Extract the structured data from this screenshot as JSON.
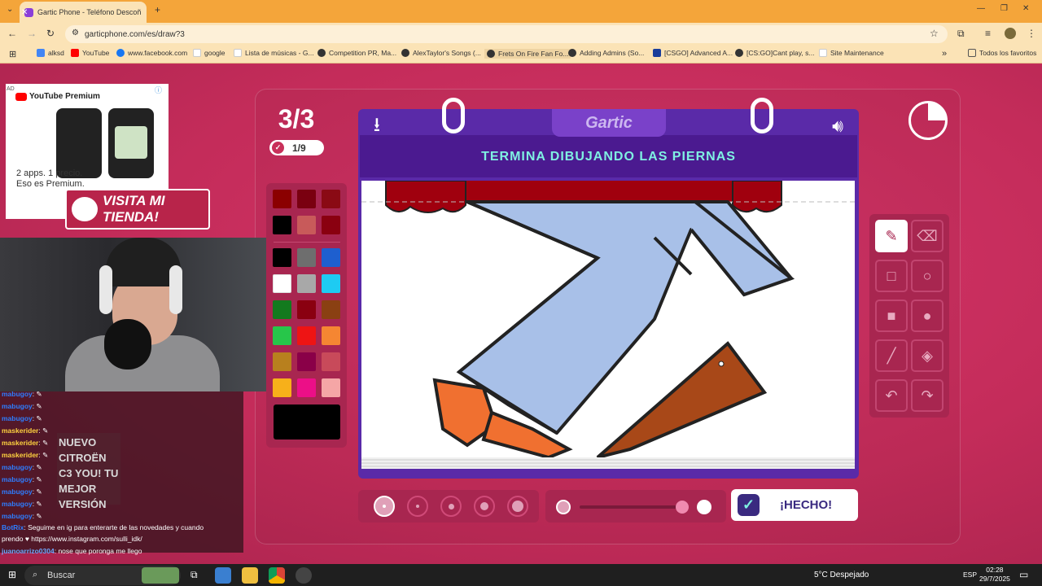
{
  "browser": {
    "tab_title": "Gartic Phone - Teléfono Descoñ",
    "url": "garticphone.com/es/draw?3",
    "bookmarks": [
      "alksd",
      "YouTube",
      "www.facebook.com",
      "google",
      "Lista de músicas - G...",
      "Competition PR, Ma...",
      "AlexTaylor's Songs (...",
      "Frets On Fire Fan Fo...",
      "Adding Admins (So...",
      "[CSGO] Advanced A...",
      "[CS:GO]Cant play, s...",
      "Site Maintenance"
    ],
    "all_bookmarks": "Todos los favoritos"
  },
  "ad": {
    "tag": "AD",
    "brand": "YouTube Premium",
    "line1": "2 apps. 1 precio.",
    "line2": "Eso es Premium."
  },
  "stream": {
    "store_banner": "VISITA MI TIENDA!",
    "car_ad": "NUEVO CITROËN C3 YOU! TU MEJOR VERSIÓN",
    "chat": [
      {
        "user": "mabugoy",
        "text": ": ✎"
      },
      {
        "user": "mabugoy",
        "text": ": ✎"
      },
      {
        "user": "mabugoy",
        "text": ": ✎"
      },
      {
        "user": "maskerider",
        "text": ": ✎"
      },
      {
        "user": "maskerider",
        "text": ": ✎"
      },
      {
        "user": "maskerider",
        "text": ": ✎"
      },
      {
        "user": "mabugoy",
        "text": ": ✎"
      },
      {
        "user": "mabugoy",
        "text": ": ✎"
      },
      {
        "user": "mabugoy",
        "text": ": ✎"
      },
      {
        "user": "mabugoy",
        "text": ": ✎"
      },
      {
        "user": "mabugoy",
        "text": ": ✎"
      },
      {
        "user": "BotRix",
        "text": ": Seguime en ig para enterarte de las novedades y cuando"
      },
      {
        "user": "",
        "text": "prendo ♥ https://www.instagram.com/sulli_idk/"
      },
      {
        "user": "juanoarrizo0304",
        "text": ": nose que poronga me llego"
      }
    ]
  },
  "game": {
    "round": "3/3",
    "done_count": "1/9",
    "logo": "Gartic",
    "prompt": "TERMINA DIBUJANDO LAS PIERNAS",
    "done_button": "¡HECHO!",
    "palette": [
      "#8b0000",
      "#7a0010",
      "#8a0a14",
      "#000000",
      "#c85a5a",
      "#8a0010",
      "#000000",
      "#6e6e6e",
      "#1e5fcf",
      "#ffffff",
      "#a8a8a8",
      "#1ecbf2",
      "#137a1e",
      "#8a0010",
      "#8a4012",
      "#27c64a",
      "#ee1414",
      "#f58632",
      "#b8801e",
      "#8a0048",
      "#c84a5a",
      "#f7b01a",
      "#ec0f87",
      "#f5a6a6"
    ],
    "selected_color": "#000000",
    "brush_sizes": [
      1,
      2,
      3,
      4,
      5
    ],
    "selected_size": 1,
    "tools": [
      "pencil-icon",
      "eraser-icon",
      "square-outline-icon",
      "circle-outline-icon",
      "square-fill-icon",
      "circle-fill-icon",
      "line-icon",
      "bucket-icon",
      "undo-icon",
      "redo-icon"
    ]
  },
  "taskbar": {
    "search": "Buscar",
    "weather": "5°C  Despejado",
    "lang": "ESP",
    "time": "02:28",
    "date": "29/7/2025"
  }
}
